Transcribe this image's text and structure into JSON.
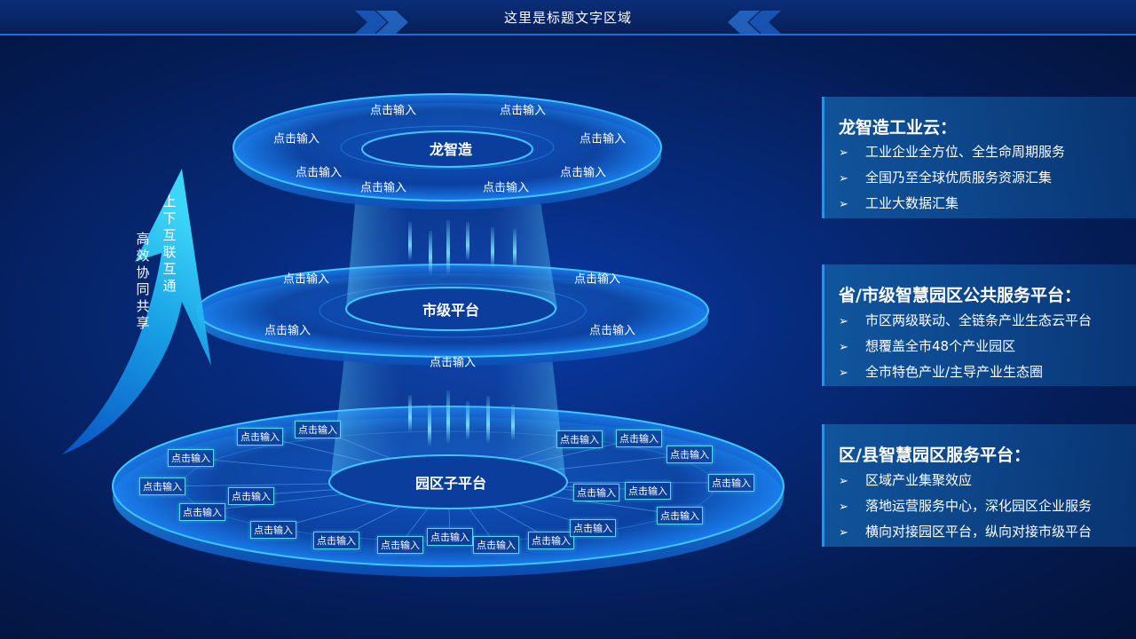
{
  "header": {
    "title": "这里是标题文字区域"
  },
  "arrow": {
    "text_right": "上下互联互通",
    "text_left": "高效协同共享"
  },
  "layers": {
    "top": {
      "name": "龙智造",
      "labels": [
        "点击输入",
        "点击输入",
        "点击输入",
        "点击输入",
        "点击输入",
        "点击输入",
        "点击输入",
        "点击输入"
      ]
    },
    "middle": {
      "name": "市级平台",
      "labels": [
        "点击输入",
        "点击输入",
        "点击输入",
        "点击输入",
        "点击输入"
      ]
    },
    "bottom": {
      "name": "园区子平台",
      "boxes": [
        "点击输入",
        "点击输入",
        "点击输入",
        "点击输入",
        "点击输入",
        "点击输入",
        "点击输入",
        "点击输入",
        "点击输入",
        "点击输入",
        "点击输入",
        "点击输入",
        "点击输入",
        "点击输入",
        "点击输入",
        "点击输入",
        "点击输入",
        "点击输入",
        "点击输入",
        "点击输入",
        "点击输入",
        "点击输入"
      ]
    }
  },
  "panels": [
    {
      "title": "龙智造工业云：",
      "items": [
        "工业企业全方位、全生命周期服务",
        "全国乃至全球优质服务资源汇集",
        "工业大数据汇集"
      ]
    },
    {
      "title": "省/市级智慧园区公共服务平台：",
      "items": [
        "市区两级联动、全链条产业生态云平台",
        "想覆盖全市48个产业园区",
        "全市特色产业/主导产业生态圈"
      ]
    },
    {
      "title": "区/县智慧园区服务平台：",
      "items": [
        "区域产业集聚效应",
        "落地运营服务中心，深化园区企业服务",
        "横向对接园区平台，纵向对接市级平台"
      ]
    }
  ],
  "bullet_marker": "➢"
}
